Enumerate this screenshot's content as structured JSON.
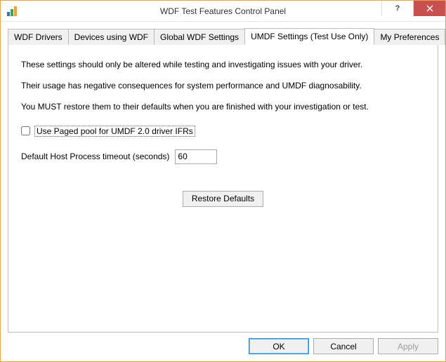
{
  "window": {
    "title": "WDF Test Features Control Panel"
  },
  "tabs": {
    "t0": "WDF Drivers",
    "t1": "Devices using WDF",
    "t2": "Global WDF Settings",
    "t3": "UMDF Settings (Test Use Only)",
    "t4": "My Preferences",
    "active_index": 3
  },
  "panel": {
    "para1": "These settings should only be altered while testing and investigating issues with your driver.",
    "para2": "Their usage has negative consequences for system performance and UMDF diagnosability.",
    "para3": "You MUST restore them to their defaults when you are finished with your investigation or test.",
    "checkbox_label": "Use Paged pool for UMDF 2.0 driver IFRs",
    "checkbox_checked": false,
    "timeout_label": "Default Host Process timeout (seconds)",
    "timeout_value": "60",
    "restore_label": "Restore Defaults"
  },
  "buttons": {
    "ok": "OK",
    "cancel": "Cancel",
    "apply": "Apply"
  }
}
